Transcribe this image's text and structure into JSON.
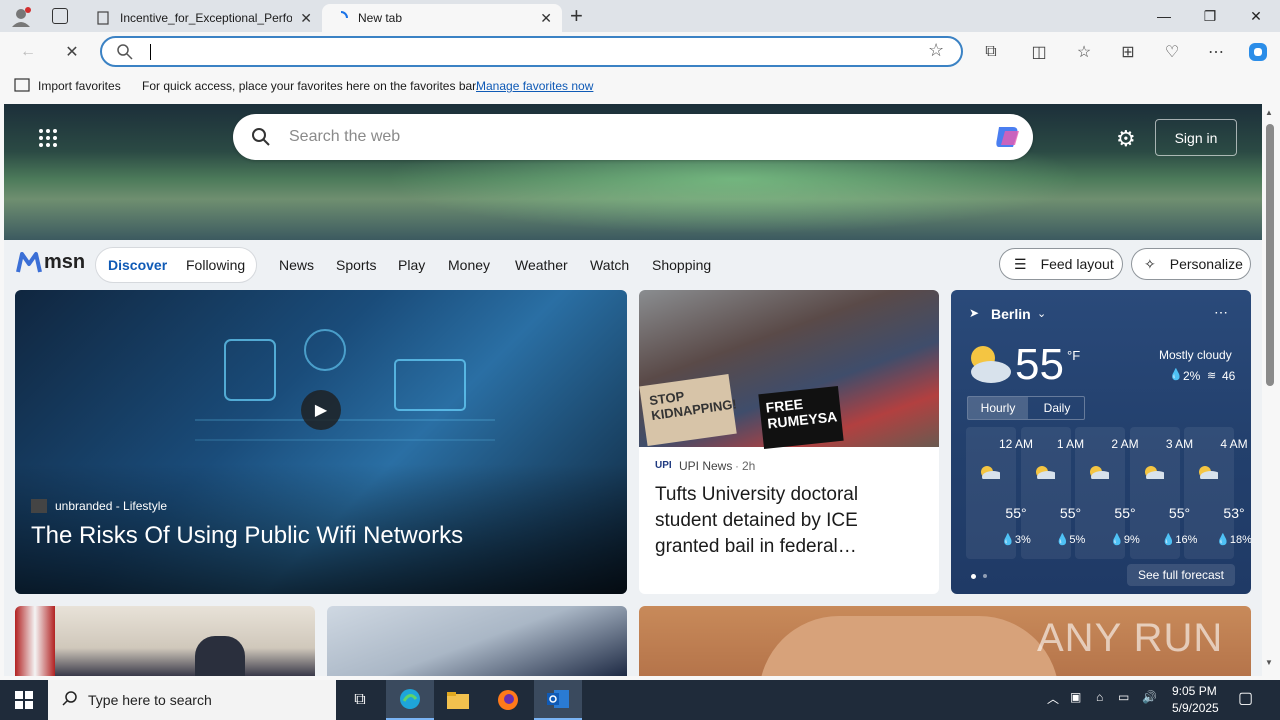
{
  "browser": {
    "tabs": [
      {
        "title": "Incentive_for_Exceptional_Perfor"
      },
      {
        "title": "New tab"
      }
    ],
    "favorites_bar": {
      "import_label": "Import favorites",
      "hint": "For quick access, place your favorites here on the favorites bar.",
      "manage_link": "Manage favorites now"
    }
  },
  "hero": {
    "search_placeholder": "Search the web",
    "signin_label": "Sign in"
  },
  "msn": {
    "logo_text": "msn",
    "tabs": [
      "Discover",
      "Following"
    ],
    "nav": [
      "News",
      "Sports",
      "Play",
      "Money",
      "Weather",
      "Watch",
      "Shopping"
    ],
    "feed_layout_label": "Feed layout",
    "personalize_label": "Personalize"
  },
  "main_story": {
    "source": "unbranded - Lifestyle",
    "title": "The Risks Of Using Public Wifi Networks"
  },
  "news_card": {
    "source_logo": "UPI",
    "source": "UPI News",
    "age": "2h",
    "title": "Tufts University doctoral student detained by ICE granted bail in federal…",
    "sign1": "STOP KIDNAPPING!",
    "sign2": "FREE RUMEYSA"
  },
  "weather": {
    "city": "Berlin",
    "temp": "55",
    "unit": "°F",
    "condition": "Mostly cloudy",
    "precip": "2%",
    "aqi": "46",
    "tabs": [
      "Hourly",
      "Daily"
    ],
    "hours": [
      {
        "time": "12 AM",
        "temp": "55°",
        "precip": "3%"
      },
      {
        "time": "1 AM",
        "temp": "55°",
        "precip": "5%"
      },
      {
        "time": "2 AM",
        "temp": "55°",
        "precip": "9%"
      },
      {
        "time": "3 AM",
        "temp": "55°",
        "precip": "16%"
      },
      {
        "time": "4 AM",
        "temp": "53°",
        "precip": "18%"
      }
    ],
    "forecast_link": "See full forecast"
  },
  "watermark": "ANY RUN",
  "taskbar": {
    "search_placeholder": "Type here to search",
    "time": "9:05 PM",
    "date": "5/9/2025"
  }
}
